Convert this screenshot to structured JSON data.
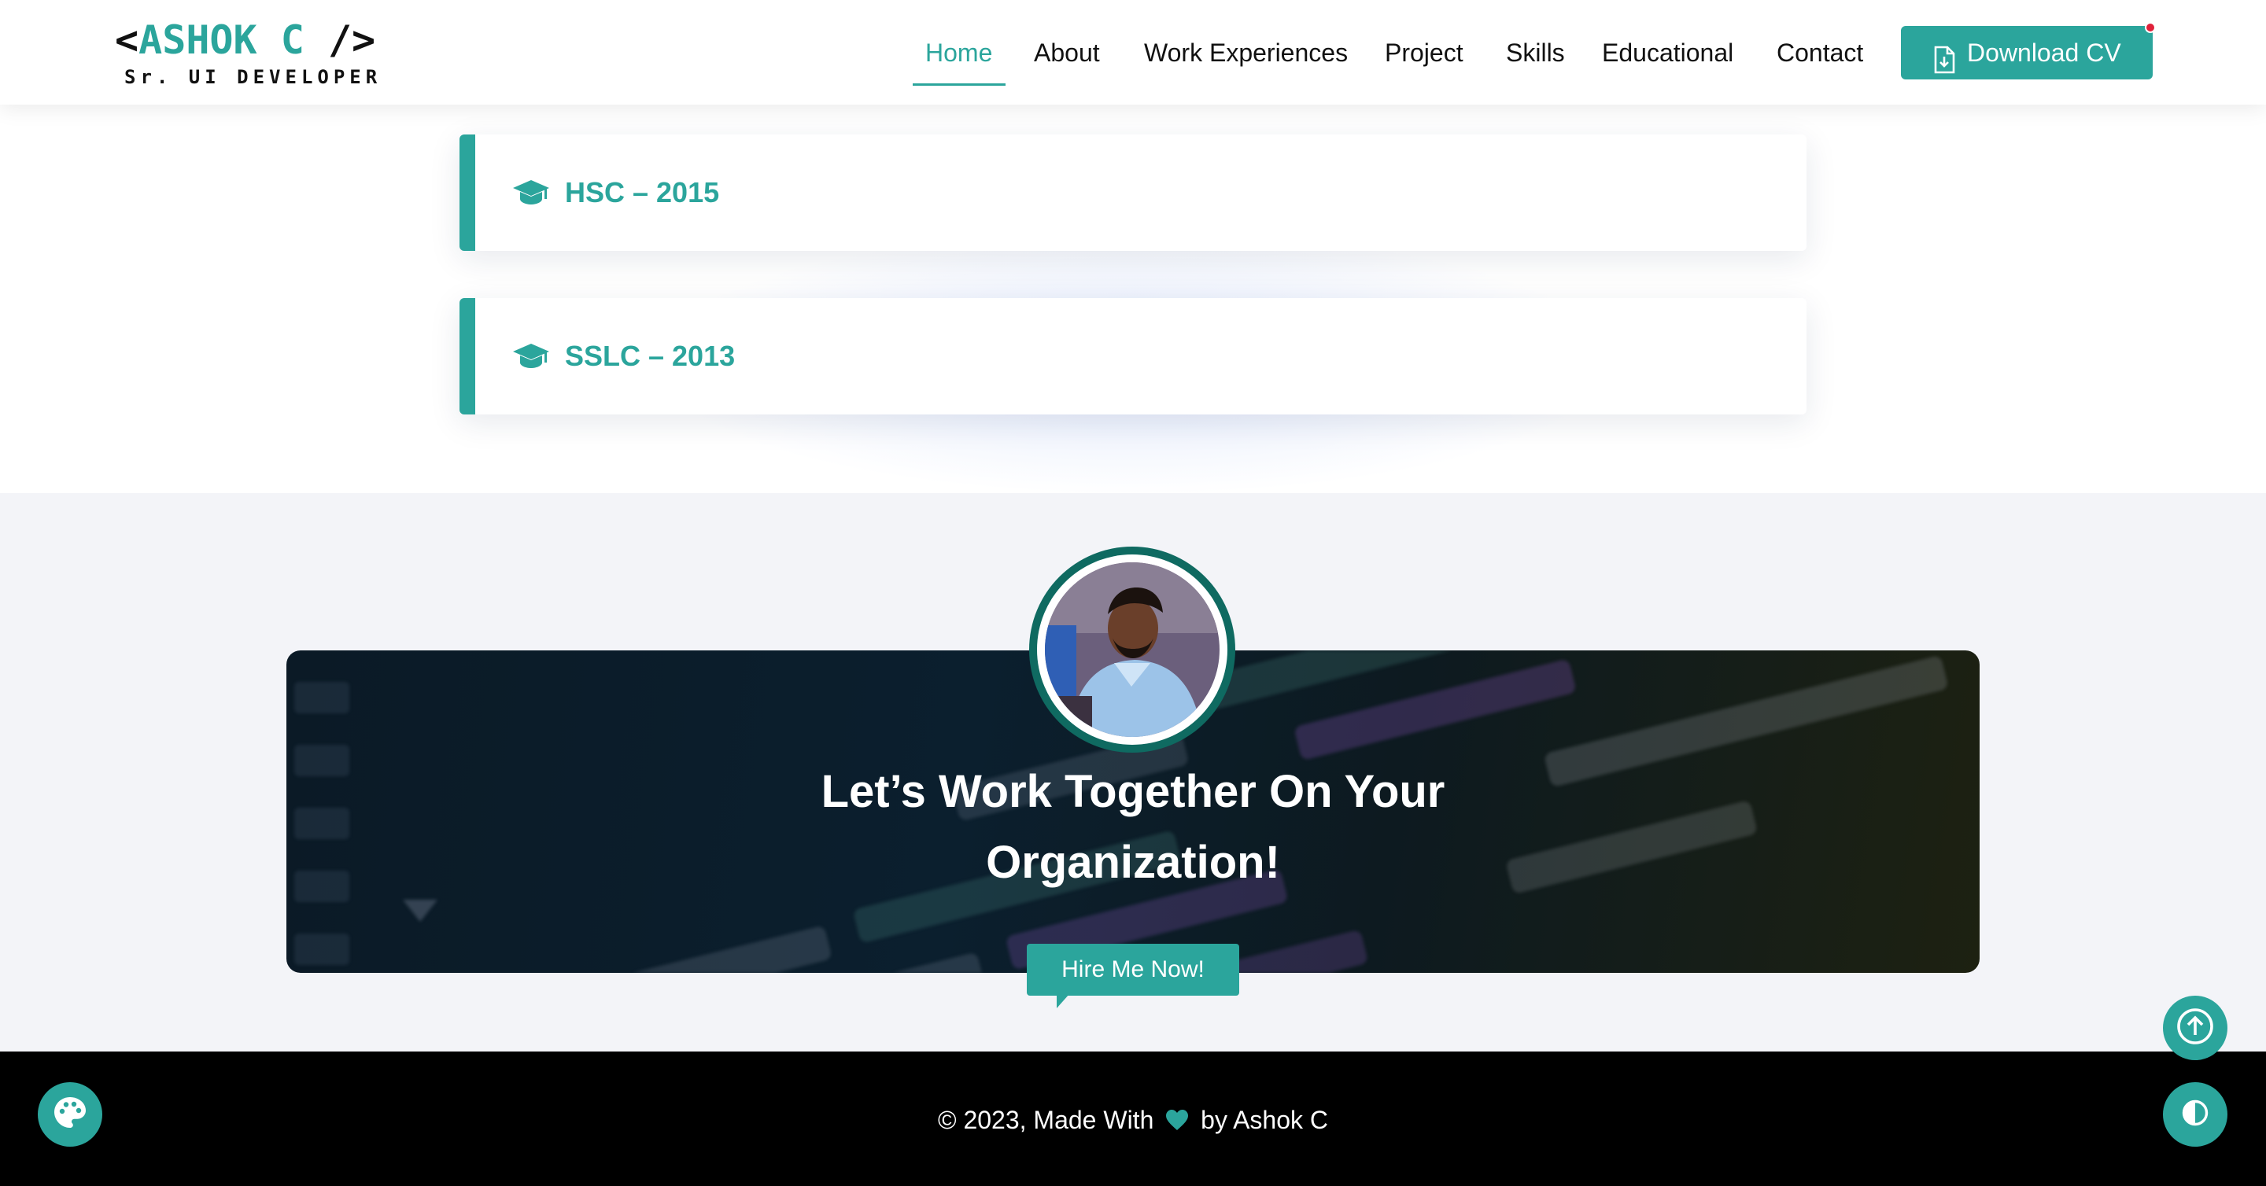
{
  "header": {
    "logo": {
      "open_bracket": "<",
      "name": "ASHOK C",
      "close_bracket": "/>",
      "tagline": "Sr. UI DEVELOPER"
    },
    "nav": [
      {
        "label": "Home",
        "active": true
      },
      {
        "label": "About",
        "active": false
      },
      {
        "label": "Work Experiences",
        "active": false
      },
      {
        "label": "Project",
        "active": false
      },
      {
        "label": "Skills",
        "active": false
      },
      {
        "label": "Educational",
        "active": false
      },
      {
        "label": "Contact",
        "active": false
      }
    ],
    "download_cv": {
      "label": "Download CV",
      "icon": "file-download-icon"
    }
  },
  "education": {
    "items": [
      {
        "title": "HSC – 2015",
        "icon": "graduation-cap-icon"
      },
      {
        "title": "SSLC – 2013",
        "icon": "graduation-cap-icon"
      }
    ]
  },
  "cta": {
    "heading_line1": "Let’s Work Together On Your",
    "heading_line2": "Organization!",
    "button": "Hire Me Now!",
    "avatar_icon": "profile-photo"
  },
  "footer": {
    "text_before": "© 2023, Made With",
    "text_after": "by Ashok C",
    "heart_icon": "heart-icon"
  },
  "floating": {
    "theme_palette_icon": "palette-icon",
    "scroll_top_icon": "arrow-up-circle-icon",
    "dark_mode_icon": "contrast-icon"
  },
  "colors": {
    "accent": "#2ba59c",
    "footer_bg": "#000000",
    "section_bg": "#f3f4f8",
    "notification_dot": "#e0213a"
  }
}
